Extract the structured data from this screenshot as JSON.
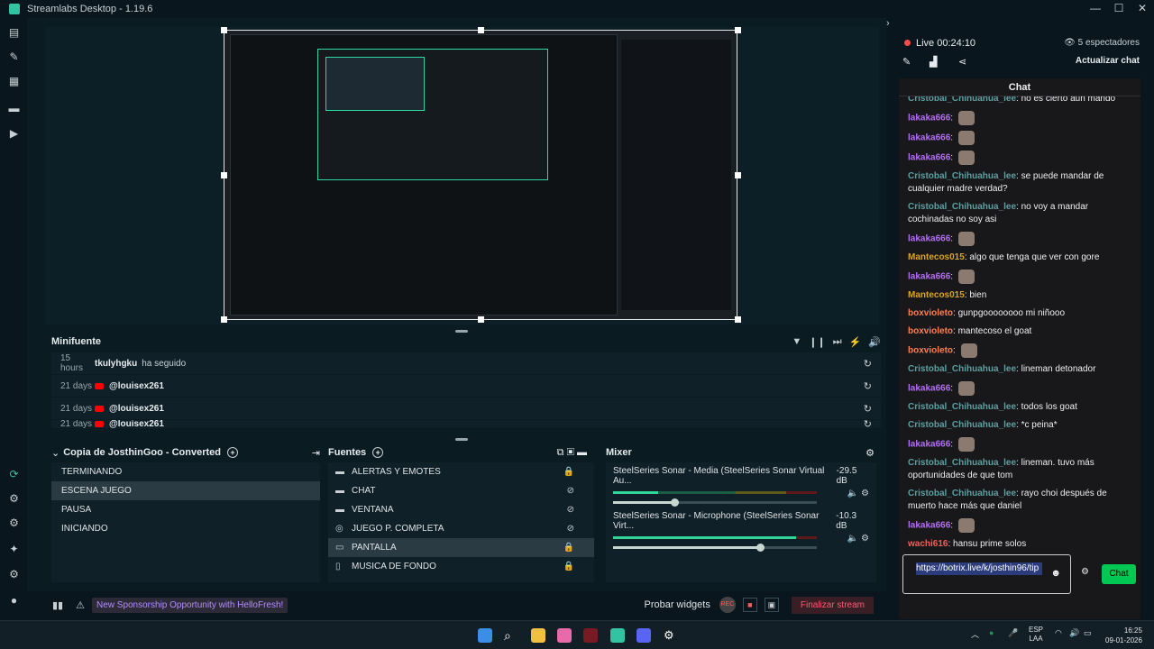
{
  "window": {
    "title": "Streamlabs Desktop - 1.19.6",
    "controls": [
      "—",
      "☐",
      "✕"
    ]
  },
  "leftnav": {
    "icons": [
      "editor-icon",
      "themes-icon",
      "store-icon",
      "library-icon",
      "play-icon",
      "studio-mode-icon",
      "layout-icon",
      "app-icon",
      "highlighter-icon",
      "settings-icon",
      "profile-icon"
    ]
  },
  "minifuente": {
    "title": "Minifuente",
    "rows": [
      {
        "time": "15 hours",
        "user": "tkulyhgku",
        "action": "ha seguido",
        "source": "follow"
      },
      {
        "time": "21 days",
        "user": "@louisex261",
        "action": "",
        "source": "youtube"
      },
      {
        "time": "21 days",
        "user": "@louisex261",
        "action": "",
        "source": "youtube"
      },
      {
        "time": "21 days",
        "user": "@louisex261",
        "action": "",
        "source": "youtube"
      }
    ]
  },
  "scenes": {
    "title": "Copia de JosthinGoo - Converted",
    "items": [
      "TERMINANDO",
      "ESCENA JUEGO",
      "PAUSA",
      "INICIANDO"
    ],
    "active_index": 1
  },
  "sources": {
    "title": "Fuentes",
    "items": [
      {
        "name": "ALERTAS Y EMOTES",
        "icon": "folder-icon",
        "status": "lock"
      },
      {
        "name": "CHAT",
        "icon": "folder-icon",
        "status": "eye-off"
      },
      {
        "name": "VENTANA",
        "icon": "folder-icon",
        "status": "eye-off"
      },
      {
        "name": "JUEGO P. COMPLETA",
        "icon": "gamepad-icon",
        "status": "eye-off"
      },
      {
        "name": "PANTALLA",
        "icon": "monitor-icon",
        "status": "lock"
      },
      {
        "name": "MUSICA DE FONDO",
        "icon": "file-icon",
        "status": "lock"
      }
    ],
    "active_index": 4
  },
  "mixer": {
    "title": "Mixer",
    "channels": [
      {
        "name": "SteelSeries Sonar - Media (SteelSeries Sonar Virtual Au...",
        "db": "-29.5 dB",
        "level": 0.22,
        "volume": 0.3
      },
      {
        "name": "SteelSeries Sonar - Microphone (SteelSeries Sonar Virt...",
        "db": "-10.3 dB",
        "level": 0.9,
        "volume": 0.72
      }
    ]
  },
  "footer": {
    "sponsor": "New Sponsorship Opportunity with HelloFresh!",
    "probar": "Probar widgets",
    "rec": "REC",
    "end": "Finalizar stream"
  },
  "right": {
    "live": "Live 00:24:10",
    "viewers": "5 espectadores",
    "update": "Actualizar chat",
    "chat_title": "Chat",
    "messages": [
      {
        "user": "Cristobal_Chihuahua_lee",
        "cls": "u-cris",
        "text": "no es cierto aun mando",
        "emote": false
      },
      {
        "user": "lakaka666",
        "cls": "u-laka",
        "text": "",
        "emote": true
      },
      {
        "user": "lakaka666",
        "cls": "u-laka",
        "text": "",
        "emote": true
      },
      {
        "user": "lakaka666",
        "cls": "u-laka",
        "text": "",
        "emote": true
      },
      {
        "user": "Cristobal_Chihuahua_lee",
        "cls": "u-cris",
        "text": "se puede mandar de cualquier madre verdad?",
        "emote": false
      },
      {
        "user": "Cristobal_Chihuahua_lee",
        "cls": "u-cris",
        "text": "no voy a mandar cochinadas no soy asi",
        "emote": false
      },
      {
        "user": "lakaka666",
        "cls": "u-laka",
        "text": "",
        "emote": true
      },
      {
        "user": "Mantecos015",
        "cls": "u-mante",
        "text": "algo que tenga que ver con gore",
        "emote": false
      },
      {
        "user": "lakaka666",
        "cls": "u-laka",
        "text": "",
        "emote": true
      },
      {
        "user": "Mantecos015",
        "cls": "u-mante",
        "text": "bien",
        "emote": false
      },
      {
        "user": "boxvioleto",
        "cls": "u-box",
        "text": "gunpgoooooooo mi niñooo",
        "emote": false
      },
      {
        "user": "boxvioleto",
        "cls": "u-box",
        "text": "mantecoso el goat",
        "emote": false
      },
      {
        "user": "boxvioleto",
        "cls": "u-box",
        "text": "",
        "emote": true
      },
      {
        "user": "Cristobal_Chihuahua_lee",
        "cls": "u-cris",
        "text": "lineman detonador",
        "emote": false
      },
      {
        "user": "lakaka666",
        "cls": "u-laka",
        "text": "",
        "emote": true
      },
      {
        "user": "Cristobal_Chihuahua_lee",
        "cls": "u-cris",
        "text": "todos los goat",
        "emote": false
      },
      {
        "user": "Cristobal_Chihuahua_lee",
        "cls": "u-cris",
        "text": "*c peina*",
        "emote": false
      },
      {
        "user": "lakaka666",
        "cls": "u-laka",
        "text": "",
        "emote": true
      },
      {
        "user": "Cristobal_Chihuahua_lee",
        "cls": "u-cris",
        "text": "lineman. tuvo más oportunidades de que tom",
        "emote": false
      },
      {
        "user": "Cristobal_Chihuahua_lee",
        "cls": "u-cris",
        "text": "rayo choi después de muerto hace más que daniel",
        "emote": false
      },
      {
        "user": "lakaka666",
        "cls": "u-laka",
        "text": "",
        "emote": true
      },
      {
        "user": "wachi616",
        "cls": "u-wachi",
        "text": "hansu prime solos",
        "emote": false
      }
    ],
    "input_value": "https://botrix.live/k/josthin96/tip",
    "send": "Chat"
  },
  "taskbar": {
    "lang": [
      "ESP",
      "LAA"
    ],
    "time": "16:25",
    "date": "09-01-2026"
  }
}
